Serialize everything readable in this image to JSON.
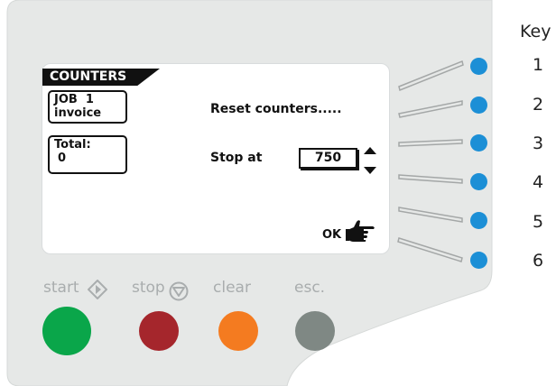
{
  "screen": {
    "title": "COUNTERS",
    "job": {
      "line1": "JOB  1",
      "line2": "invoice"
    },
    "total": {
      "line1": "Total:",
      "line2": "0"
    },
    "reset_label": "Reset counters.....",
    "stop_label": "Stop at",
    "stop_value": "750",
    "ok_label": "OK"
  },
  "key": {
    "title": "Key",
    "numbers": [
      "1",
      "2",
      "3",
      "4",
      "5",
      "6"
    ]
  },
  "controls": {
    "start_label": "start",
    "stop_label": "stop",
    "clear_label": "clear",
    "esc_label": "esc."
  },
  "colors": {
    "panel": "#e6e8e7",
    "softkey": "#1c8fd6",
    "start": "#0aa64a",
    "stop": "#a5262c",
    "clear": "#f47b20",
    "esc": "#7f8884"
  },
  "icons": {
    "start": "start-diamond-icon",
    "stop": "stop-triangle-icon",
    "ok": "pointing-hand-icon"
  }
}
